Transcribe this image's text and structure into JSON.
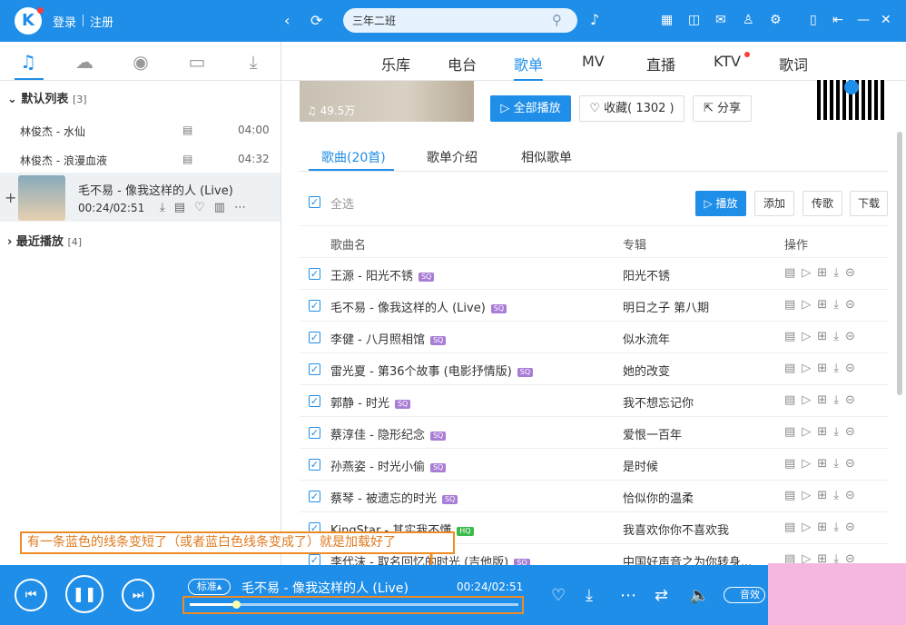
{
  "header": {
    "logo_letter": "K",
    "login": "登录",
    "register": "注册",
    "search_value": "三年二班",
    "colors": {
      "brand": "#1f8ee8",
      "notify": "#ff3b3b"
    }
  },
  "main_nav": {
    "tabs": [
      "乐库",
      "电台",
      "歌单",
      "MV",
      "直播",
      "KTV",
      "歌词"
    ],
    "active": "歌单"
  },
  "sidebar": {
    "default_list": {
      "title": "默认列表",
      "count": "[3]"
    },
    "songs": [
      {
        "title": "林俊杰 - 水仙",
        "time": "04:00"
      },
      {
        "title": "林俊杰 - 浪漫血液",
        "time": "04:32"
      }
    ],
    "now_playing": {
      "title": "毛不易 - 像我这样的人 (Live)",
      "time": "00:24/02:51"
    },
    "recent": {
      "title": "最近播放",
      "count": "[4]"
    },
    "plus": "+"
  },
  "playlist": {
    "play_count": "49.5万",
    "play_all": "全部播放",
    "favorite": "收藏( 1302 )",
    "share": "分享",
    "subtabs": [
      "歌曲(20首)",
      "歌单介绍",
      "相似歌单"
    ],
    "select_all": "全选",
    "toolbar": {
      "play": "播放",
      "add": "添加",
      "send": "传歌",
      "download": "下载"
    },
    "columns": {
      "song": "歌曲名",
      "album": "专辑",
      "ops": "操作"
    },
    "rows": [
      {
        "song": "王源 - 阳光不锈",
        "badge": "SQ",
        "album": "阳光不锈"
      },
      {
        "song": "毛不易 - 像我这样的人 (Live)",
        "badge": "SQ",
        "album": "明日之子 第八期"
      },
      {
        "song": "李健 - 八月照相馆",
        "badge": "SQ",
        "album": "似水流年"
      },
      {
        "song": "雷光夏 - 第36个故事 (电影抒情版)",
        "badge": "SQ",
        "album": "她的改变"
      },
      {
        "song": "郭静 - 时光",
        "badge": "SQ",
        "album": "我不想忘记你"
      },
      {
        "song": "蔡淳佳 - 隐形纪念",
        "badge": "SQ",
        "album": "爱恨一百年"
      },
      {
        "song": "孙燕姿 - 时光小偷",
        "badge": "SQ",
        "album": "是时候"
      },
      {
        "song": "蔡琴 - 被遗忘的时光",
        "badge": "SQ",
        "album": "恰似你的温柔"
      },
      {
        "song": "KingStar - 其实我不懂",
        "badge": "HQ",
        "album": "我喜欢你你不喜欢我"
      },
      {
        "song": "李代沫 - 取名回忆的时光 (吉他版)",
        "badge": "SQ",
        "album": "中国好声音之为你转身..."
      }
    ]
  },
  "player": {
    "quality": "标准",
    "title": "毛不易 - 像我这样的人 (Live)",
    "time": "00:24/02:51",
    "progress": 0.14,
    "volume_label": "音效"
  },
  "annotation": {
    "text": "有一条蓝色的线条变短了（或者蓝白色线条变成了）就是加载好了",
    "color": "#f08a24"
  }
}
